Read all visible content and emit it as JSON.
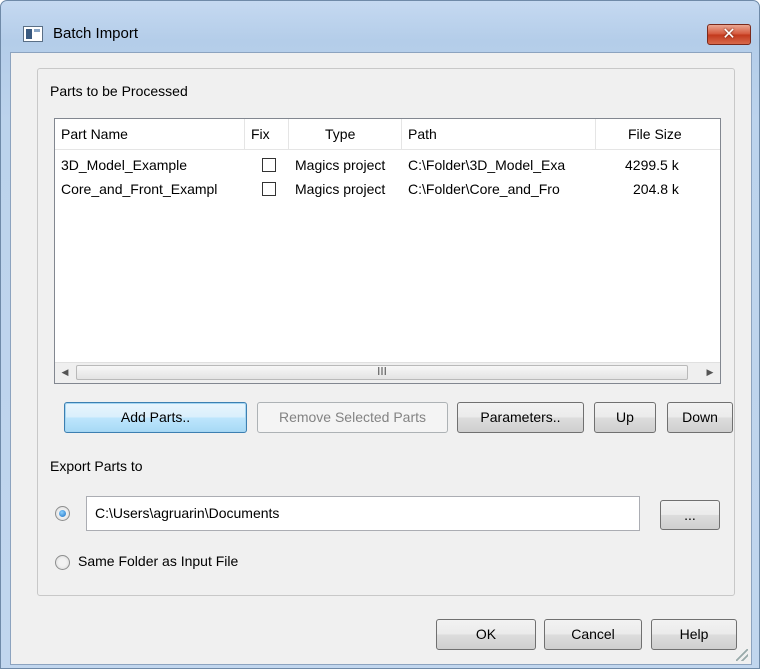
{
  "window": {
    "title": "Batch Import",
    "close_glyph": "✕"
  },
  "parts_group": {
    "label": "Parts to be Processed",
    "columns": [
      "Part Name",
      "Fix",
      "Type",
      "Path",
      "File Size"
    ],
    "rows": [
      {
        "part_name": "3D_Model_Example",
        "fix": false,
        "type": "Magics project",
        "path": "C:\\Folder\\3D_Model_Exa",
        "file_size": "4299.5 k"
      },
      {
        "part_name": "Core_and_Front_Exampl",
        "fix": false,
        "type": "Magics project",
        "path": "C:\\Folder\\Core_and_Fro",
        "file_size": "204.8 k"
      }
    ],
    "scrollbar": {
      "left_arrow": "◀",
      "right_arrow": "▶",
      "thumb_grip": "III"
    }
  },
  "buttons": {
    "add_parts": "Add Parts..",
    "remove_selected": "Remove Selected Parts",
    "parameters": "Parameters..",
    "up": "Up",
    "down": "Down",
    "browse": "...",
    "ok": "OK",
    "cancel": "Cancel",
    "help": "Help"
  },
  "export": {
    "label": "Export Parts to",
    "path_value": "C:\\Users\\agruarin\\Documents",
    "same_folder_label": "Same Folder as Input File",
    "selected_option": "path"
  }
}
